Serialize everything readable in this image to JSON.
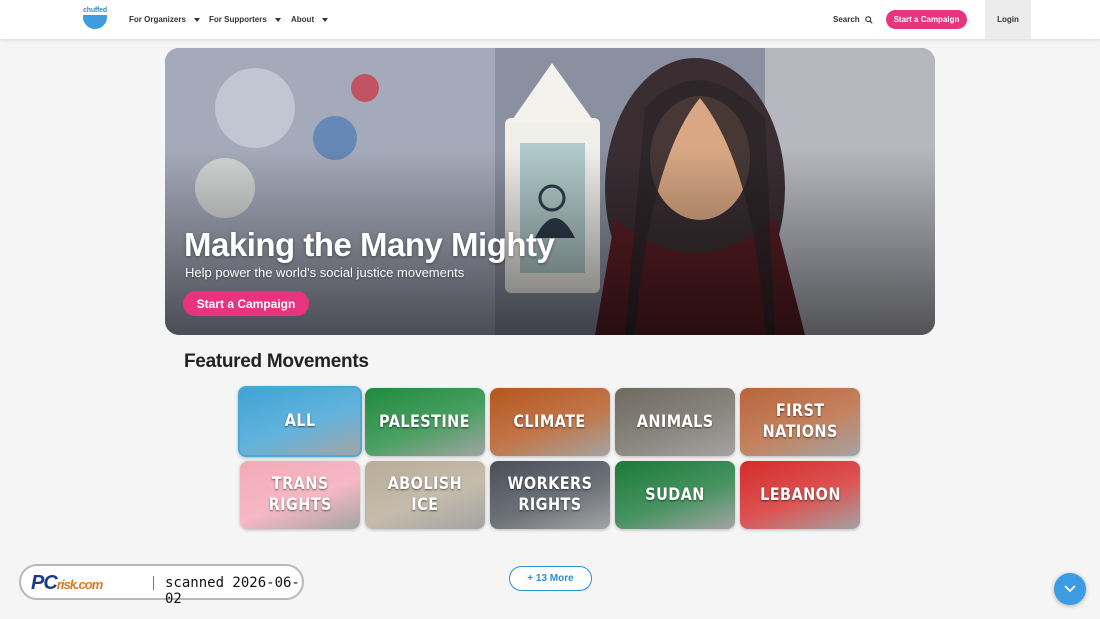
{
  "header": {
    "logo_text": "chuffed",
    "nav": [
      {
        "label": "For Organizers"
      },
      {
        "label": "For Supporters"
      },
      {
        "label": "About"
      }
    ],
    "search_label": "Search",
    "start_campaign_label": "Start a Campaign",
    "login_label": "Login"
  },
  "hero": {
    "title": "Making the Many Mighty",
    "subtitle": "Help power the world's social justice movements",
    "button_label": "Start a Campaign"
  },
  "featured": {
    "title": "Featured Movements",
    "tiles": [
      {
        "label": "ALL",
        "color": "#3ea3d6"
      },
      {
        "label": "PALESTINE",
        "color": "#1f8a3e"
      },
      {
        "label": "CLIMATE",
        "color": "#b5561f"
      },
      {
        "label": "ANIMALS",
        "color": "#6e6a60"
      },
      {
        "label": "FIRST\nNATIONS",
        "color": "#b8653a"
      },
      {
        "label": "TRANS\nRIGHTS",
        "color": "#f5a9b8"
      },
      {
        "label": "ABOLISH\nICE",
        "color": "#b9ad98"
      },
      {
        "label": "WORKERS\nRIGHTS",
        "color": "#4a4f58"
      },
      {
        "label": "SUDAN",
        "color": "#1a7a3a"
      },
      {
        "label": "LEBANON",
        "color": "#d62b2b"
      }
    ],
    "more_label": "+ 13 More"
  },
  "watermark": {
    "brand_pc": "PC",
    "brand_rest": "risk.com",
    "text": "scanned 2026-06-02"
  }
}
